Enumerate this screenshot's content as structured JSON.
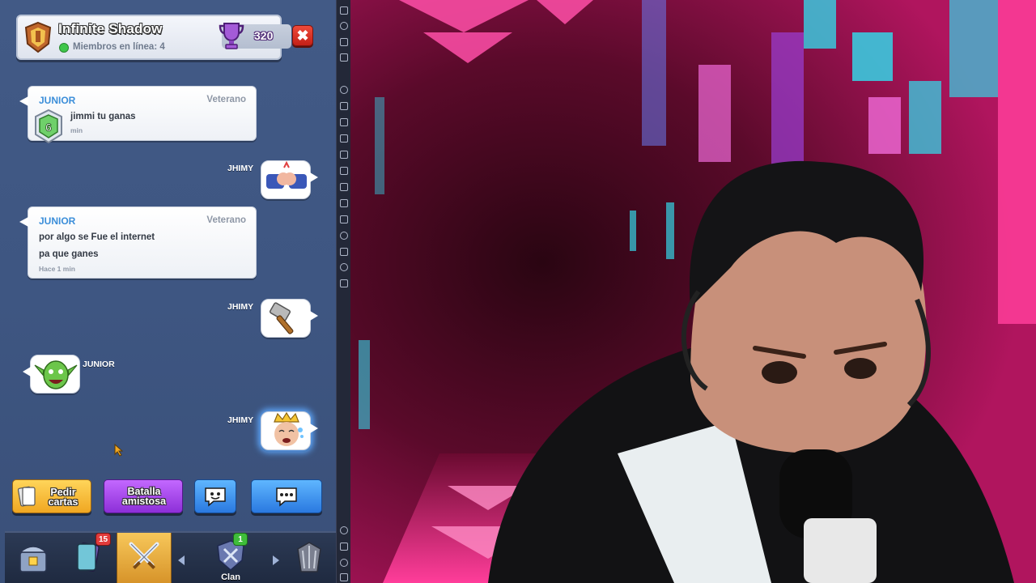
{
  "clan": {
    "name": "Infinite Shadow",
    "online_label": "Miembros en línea: 4",
    "trophies": "320",
    "close_symbol": "✖"
  },
  "chat": {
    "messages": [
      {
        "author": "JUNIOR",
        "role": "Veterano",
        "lines": [
          "jimmi tu ganas"
        ],
        "time": "min",
        "level": "6"
      },
      {
        "author": "JUNIOR",
        "role": "Veterano",
        "lines": [
          "por algo se Fue el internet",
          "pa que ganes"
        ],
        "time": "Hace 1  min"
      }
    ],
    "emotes": [
      {
        "author": "JHIMY",
        "icon": "fist-bump-emote-icon"
      },
      {
        "author": "JHIMY",
        "icon": "hammer-emote-icon"
      },
      {
        "author": "JUNIOR",
        "icon": "goblin-laugh-emote-icon"
      },
      {
        "author": "JHIMY",
        "icon": "crying-king-emote-icon"
      }
    ]
  },
  "actions": {
    "request_cards": "Pedir cartas",
    "friendly_battle": "Batalla amistosa",
    "emote_icon": "smile-icon",
    "chat_icon": "speech-bubble-icon"
  },
  "nav": {
    "tabs": [
      "shop-icon",
      "cards-icon",
      "battle-icon",
      "clan-icon",
      "events-icon"
    ],
    "cards_badge": "15",
    "clan_badge": "1",
    "clan_label": "Clan"
  },
  "colors": {
    "panel_bg": "#3e5682",
    "name_blue": "#3b8ed9",
    "request_yellow": "#f0a722",
    "friendly_purple": "#8d2fd8",
    "chat_blue": "#2a79e0",
    "stream_pink": "#ff3d9a",
    "stream_cyan": "#35d3e6"
  }
}
